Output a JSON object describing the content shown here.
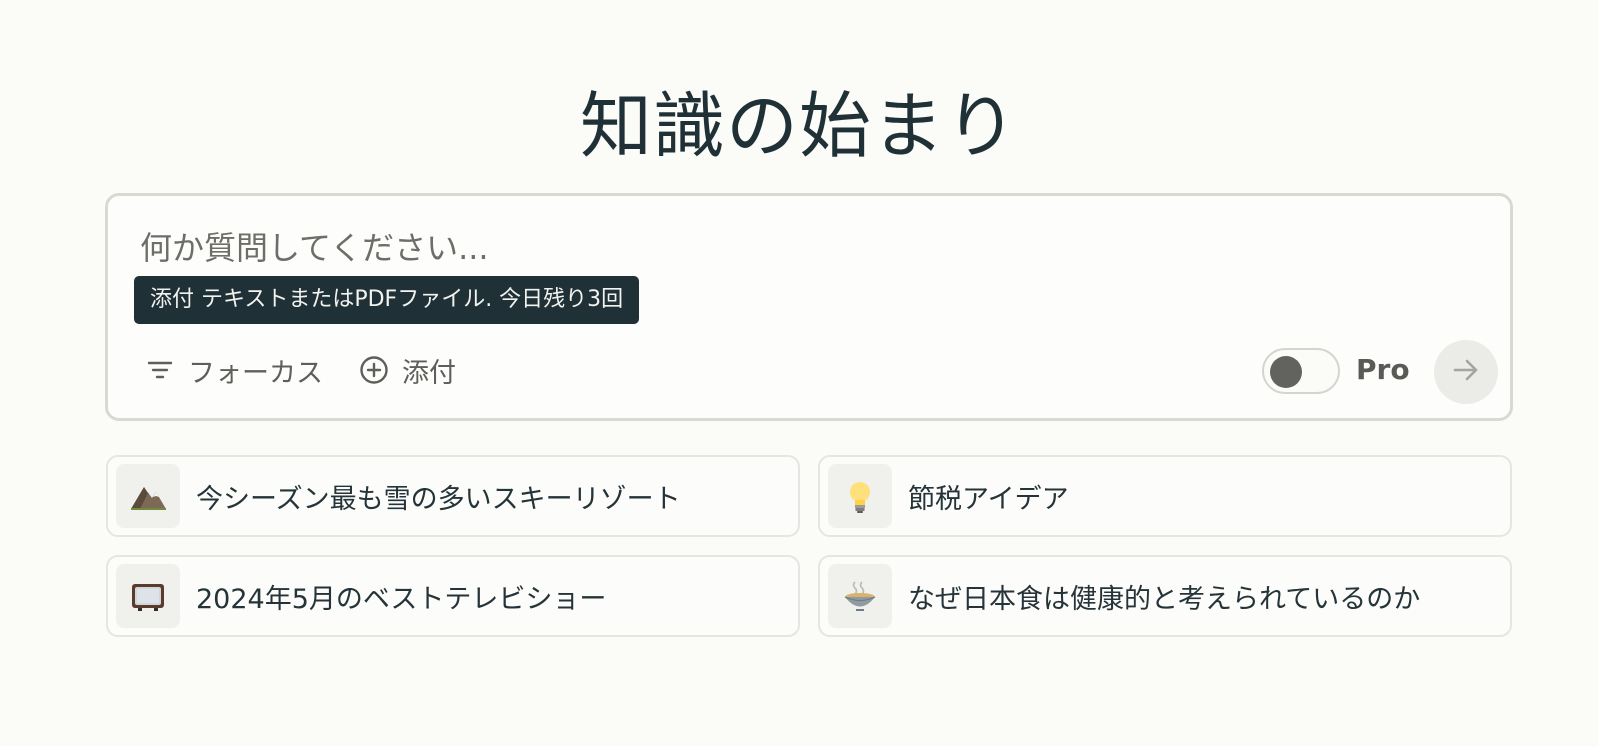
{
  "hero": {
    "title": "知識の始まり"
  },
  "ask": {
    "placeholder": "何か質問してください...",
    "tooltip": "添付 テキストまたはPDFファイル. 今日残り3回",
    "focus_label": "フォーカス",
    "attach_label": "添付",
    "pro_label": "Pro",
    "pro_enabled": false
  },
  "suggestions": [
    {
      "icon": "mountain-icon",
      "text": "今シーズン最も雪の多いスキーリゾート"
    },
    {
      "icon": "lightbulb-icon",
      "text": "節税アイデア"
    },
    {
      "icon": "television-icon",
      "text": "2024年5月のベストテレビショー"
    },
    {
      "icon": "ramen-bowl-icon",
      "text": "なぜ日本食は健康的と考えられているのか"
    }
  ],
  "colors": {
    "background": "#fbfbf7",
    "text_primary": "#1f3137",
    "tooltip_bg": "#1f3137",
    "border": "#d9d9d4"
  }
}
